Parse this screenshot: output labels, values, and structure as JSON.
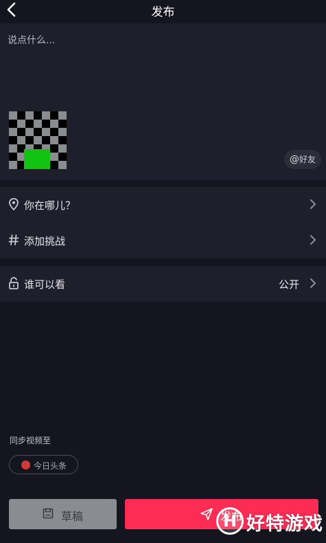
{
  "header": {
    "title": "发布",
    "back_icon": "chevron-left-icon"
  },
  "compose": {
    "placeholder": "说点什么...",
    "mention_at": "@",
    "mention_label": "好友"
  },
  "location_group": {
    "items": [
      {
        "icon": "location-pin-icon",
        "label": "你在哪儿？"
      },
      {
        "icon": "hashtag-icon",
        "label": "添加挑战"
      }
    ]
  },
  "privacy": {
    "icon": "unlock-icon",
    "label": "谁可以看",
    "value": "公开"
  },
  "sync": {
    "title": "同步视频至",
    "chip_label": "今日头条"
  },
  "actions": {
    "draft_label": "草稿",
    "publish_label": "发布"
  },
  "watermark": {
    "logo_letter": "H",
    "text": "好特游戏"
  },
  "colors": {
    "background": "#151520",
    "panel": "#1e1f2b",
    "publish": "#fd2c55",
    "draft": "#8b8b92"
  }
}
